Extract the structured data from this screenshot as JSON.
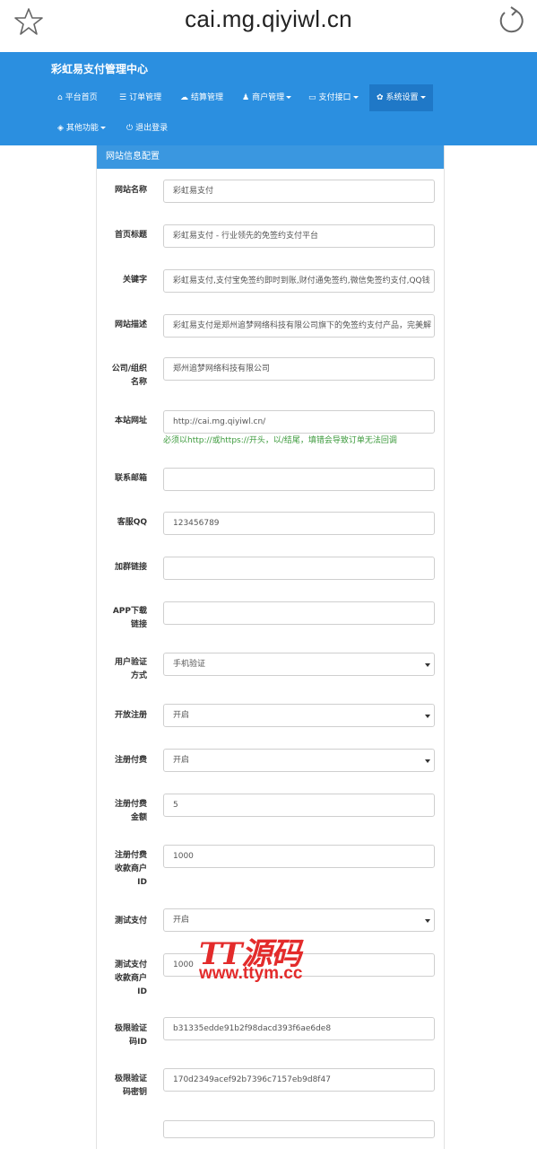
{
  "browser": {
    "url": "cai.mg.qiyiwl.cn"
  },
  "nav": {
    "brand": "彩虹易支付管理中心",
    "items": [
      {
        "icon": "home-icon",
        "glyph": "⌂",
        "label": "平台首页",
        "caret": false
      },
      {
        "icon": "list-icon",
        "glyph": "☰",
        "label": "订单管理",
        "caret": false
      },
      {
        "icon": "cloud-icon",
        "glyph": "☁",
        "label": "结算管理",
        "caret": false
      },
      {
        "icon": "user-icon",
        "glyph": "♟",
        "label": "商户管理",
        "caret": true
      },
      {
        "icon": "card-icon",
        "glyph": "▭",
        "label": "支付接口",
        "caret": true
      },
      {
        "icon": "gear-icon",
        "glyph": "✿",
        "label": "系统设置",
        "caret": true,
        "active": true
      },
      {
        "icon": "cube-icon",
        "glyph": "◈",
        "label": "其他功能",
        "caret": true
      },
      {
        "icon": "power-icon",
        "glyph": "⏻",
        "label": "退出登录",
        "caret": false
      }
    ]
  },
  "panel": {
    "title": "网站信息配置"
  },
  "form": {
    "site_name": {
      "label": "网站名称",
      "value": "彩虹易支付"
    },
    "home_title": {
      "label": "首页标题",
      "value": "彩虹易支付 - 行业领先的免签约支付平台"
    },
    "keywords": {
      "label": "关键字",
      "value": "彩虹易支付,支付宝免签约即时到账,财付通免签约,微信免签约支付,QQ钱"
    },
    "description": {
      "label": "网站描述",
      "value": "彩虹易支付是郑州追梦网络科技有限公司旗下的免签约支付产品，完美解"
    },
    "company": {
      "label1": "公司/组织",
      "label2": "名称",
      "value": "郑州追梦网络科技有限公司"
    },
    "site_url": {
      "label": "本站网址",
      "value": "http://cai.mg.qiyiwl.cn/",
      "help": "必须以http://或https://开头，以/结尾，填错会导致订单无法回调"
    },
    "email": {
      "label": "联系邮箱",
      "value": ""
    },
    "qq": {
      "label": "客服QQ",
      "value": "123456789"
    },
    "group_link": {
      "label": "加群链接",
      "value": ""
    },
    "app_link": {
      "label1": "APP下载",
      "label2": "链接",
      "value": ""
    },
    "verify_method": {
      "label1": "用户验证",
      "label2": "方式",
      "value": "手机验证"
    },
    "open_register": {
      "label": "开放注册",
      "value": "开启"
    },
    "register_pay": {
      "label": "注册付费",
      "value": "开启"
    },
    "register_fee": {
      "label1": "注册付费",
      "label2": "金额",
      "value": "5"
    },
    "register_merchant": {
      "label1": "注册付费",
      "label2": "收款商户",
      "label3": "ID",
      "value": "1000"
    },
    "test_pay": {
      "label": "测试支付",
      "value": "开启"
    },
    "test_merchant": {
      "label1": "测试支付",
      "label2": "收款商户",
      "label3": "ID",
      "value": "1000"
    },
    "geetest_id": {
      "label1": "极限验证",
      "label2": "码ID",
      "value": "b31335edde91b2f98dacd393f6ae6de8"
    },
    "geetest_key": {
      "label1": "极限验证",
      "label2": "码密钥",
      "value": "170d2349acef92b7396c7157eb9d8f47"
    }
  },
  "watermark": {
    "title": "TT源码",
    "url": "www.ttym.cc"
  }
}
